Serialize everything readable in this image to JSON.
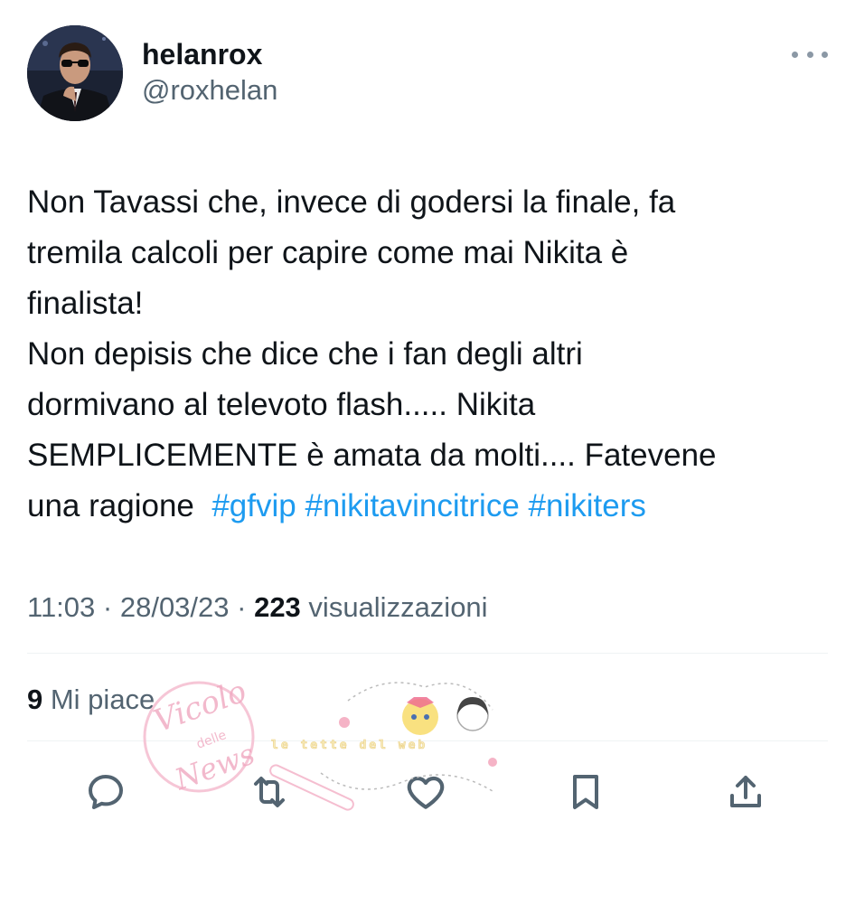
{
  "user": {
    "display_name": "helanrox",
    "handle": "@roxhelan"
  },
  "tweet": {
    "line1": "Non Tavassi che, invece di godersi la finale, fa\ntremila calcoli per capire come mai Nikita è\nfinalista!\nNon depisis che dice che i fan degli altri\ndormivano al televoto flash..... Nikita\nSEMPLICEMENTE è amata da molti.... Fatevene\nuna ragione  ",
    "hashtags": [
      "#gfvip",
      "#nikitavincitrice",
      "#nikiters"
    ]
  },
  "meta": {
    "time": "11:03",
    "separator": " · ",
    "date": "28/03/23",
    "views_count": "223",
    "views_label": " visualizzazioni"
  },
  "stats": {
    "likes_count": "9",
    "likes_label": " Mi piace"
  },
  "actions": [
    {
      "icon": "reply-icon"
    },
    {
      "icon": "retweet-icon"
    },
    {
      "icon": "like-icon"
    },
    {
      "icon": "bookmark-icon"
    },
    {
      "icon": "share-icon"
    }
  ],
  "watermark": {
    "stamp_line1": "Vicolo",
    "stamp_line2": "delle",
    "stamp_line3": "News",
    "banner": "le tette del web"
  },
  "colors": {
    "text": "#0f1419",
    "secondary": "#536471",
    "accent": "#1d9bf0",
    "divider": "#eff3f4",
    "icon": "#536471"
  }
}
